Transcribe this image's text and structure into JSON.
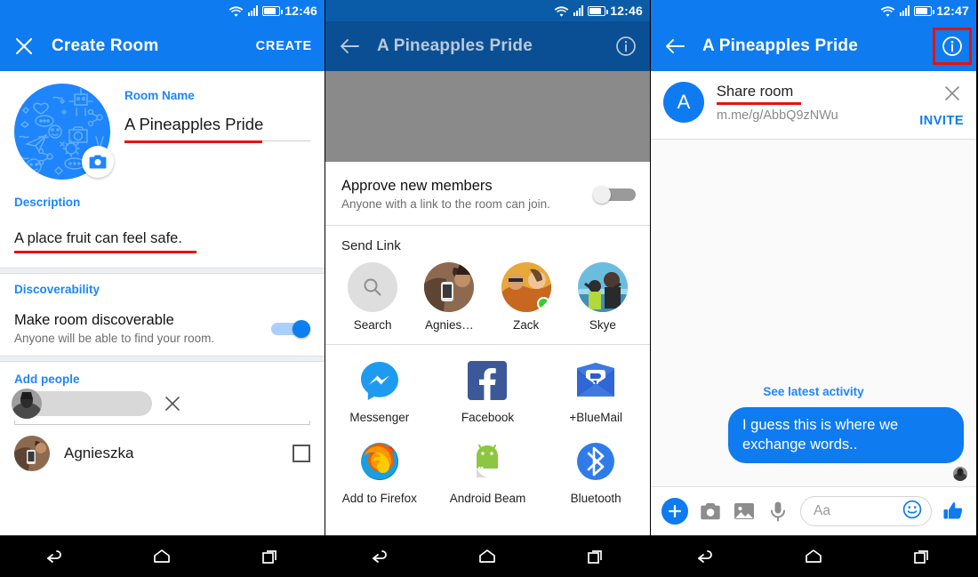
{
  "screen1": {
    "status": {
      "time": "12:46",
      "wifi_icon": "wifi-icon",
      "signal_icon": "signal-icon",
      "battery_icon": "battery-icon"
    },
    "toolbar": {
      "close_icon": "close-icon",
      "title": "Create Room",
      "action": "CREATE"
    },
    "avatar": {
      "camera_icon": "camera-icon"
    },
    "room_name": {
      "label": "Room Name",
      "value": "A Pineapples Pride"
    },
    "description": {
      "label": "Description",
      "value": "A place fruit can feel safe."
    },
    "discoverability": {
      "label": "Discoverability",
      "title": "Make room discoverable",
      "subtitle": "Anyone will be able to find your room.",
      "toggle_state": "on"
    },
    "add_people": {
      "label": "Add people",
      "clear_icon": "close-icon",
      "person": {
        "name": "Agnieszka",
        "checkbox_state": "unchecked"
      }
    }
  },
  "screen2": {
    "status": {
      "time": "12:46",
      "wifi_icon": "wifi-icon",
      "signal_icon": "signal-icon",
      "battery_icon": "battery-icon"
    },
    "toolbar": {
      "back_icon": "back-arrow-icon",
      "title": "A Pineapples Pride",
      "info_icon": "info-icon"
    },
    "approve": {
      "title": "Approve new members",
      "subtitle": "Anyone with a link to the room can join.",
      "toggle_state": "off"
    },
    "send_link": {
      "label": "Send Link",
      "contacts": [
        {
          "name": "Search",
          "icon": "search-icon",
          "online": false
        },
        {
          "name": "Agnies…",
          "icon": "avatar",
          "online": false
        },
        {
          "name": "Zack",
          "icon": "avatar",
          "online": true
        },
        {
          "name": "Skye",
          "icon": "avatar",
          "online": false
        }
      ],
      "apps": [
        {
          "name": "Messenger",
          "icon": "messenger-icon"
        },
        {
          "name": "Facebook",
          "icon": "facebook-icon"
        },
        {
          "name": "+BlueMail",
          "icon": "bluemail-icon"
        },
        {
          "name": "Add to Firefox",
          "icon": "firefox-icon"
        },
        {
          "name": "Android Beam",
          "icon": "android-icon"
        },
        {
          "name": "Bluetooth",
          "icon": "bluetooth-icon"
        }
      ]
    }
  },
  "screen3": {
    "status": {
      "time": "12:47",
      "wifi_icon": "wifi-icon",
      "signal_icon": "signal-icon",
      "battery_icon": "battery-icon"
    },
    "toolbar": {
      "back_icon": "back-arrow-icon",
      "title": "A Pineapples Pride",
      "info_icon": "info-icon",
      "annotation_color": "#e8120c"
    },
    "share": {
      "avatar_letter": "A",
      "title": "Share room",
      "url": "m.me/g/AbbQ9zNWu",
      "close_icon": "close-icon",
      "invite_label": "INVITE"
    },
    "chat": {
      "latest_activity": "See latest activity",
      "message": "I guess this is where we exchange words.."
    },
    "composer": {
      "plus_icon": "plus-icon",
      "camera_icon": "camera-icon",
      "gallery_icon": "gallery-icon",
      "mic_icon": "microphone-icon",
      "placeholder": "Aa",
      "emoji_icon": "emoji-icon",
      "like_icon": "thumbs-up-icon"
    }
  },
  "navbar": {
    "back_icon": "back-icon",
    "home_icon": "home-icon",
    "recents_icon": "recents-icon"
  },
  "colors": {
    "accent": "#0e7bf0",
    "accent_dark": "#0a4f93",
    "annotation": "#e8120c",
    "online": "#35cc35"
  }
}
